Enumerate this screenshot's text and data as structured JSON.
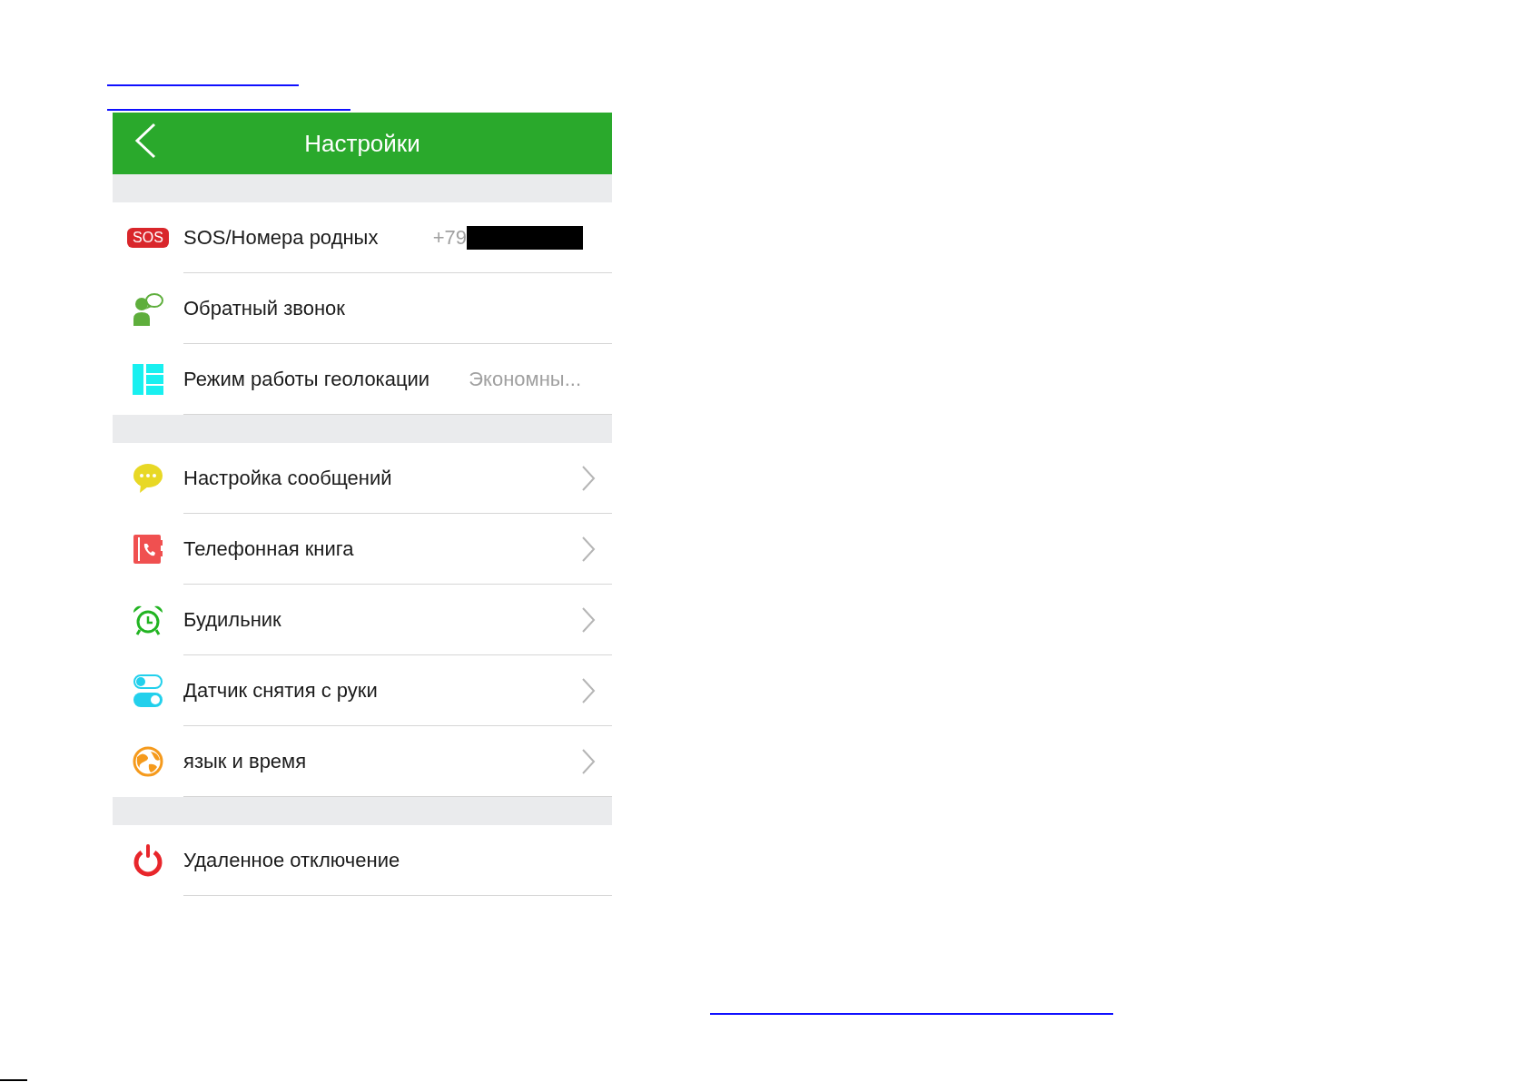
{
  "header": {
    "title": "Настройки"
  },
  "groups": [
    {
      "items": [
        {
          "kind": "value",
          "badge": "SOS",
          "label": "SOS/Номера родных",
          "value": "+79",
          "redacted": true
        },
        {
          "kind": "plain",
          "label": "Обратный звонок"
        },
        {
          "kind": "value",
          "label": "Режим работы геолокации",
          "value": "Экономны..."
        }
      ]
    },
    {
      "items": [
        {
          "kind": "link",
          "label": "Настройка сообщений"
        },
        {
          "kind": "link",
          "label": "Телефонная книга"
        },
        {
          "kind": "link",
          "label": "Будильник"
        },
        {
          "kind": "link",
          "label": "Датчик снятия с руки"
        },
        {
          "kind": "link",
          "label": "язык и время"
        }
      ]
    },
    {
      "items": [
        {
          "kind": "plain",
          "label": "Удаленное отключение"
        }
      ]
    }
  ]
}
